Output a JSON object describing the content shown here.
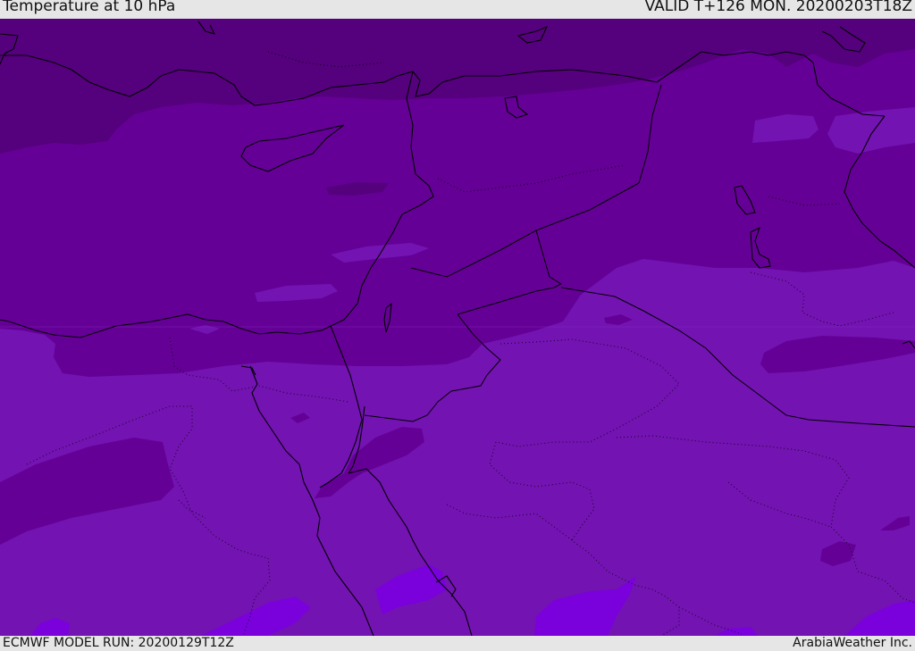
{
  "header": {
    "title": "Temperature at 10 hPa",
    "valid_time": "VALID T+126 MON. 20200203T18Z"
  },
  "footer": {
    "model_run": "ECMWF MODEL RUN: 20200129T12Z",
    "credit": "ArabiaWeather Inc."
  },
  "map": {
    "colors": {
      "band_darkest": "#55007d",
      "band_dark": "#650096",
      "band_mid": "#7313b2",
      "band_light": "#7d22be",
      "band_lightest": "#7a00dc",
      "coastline": "#000000",
      "border": "#000000"
    }
  }
}
